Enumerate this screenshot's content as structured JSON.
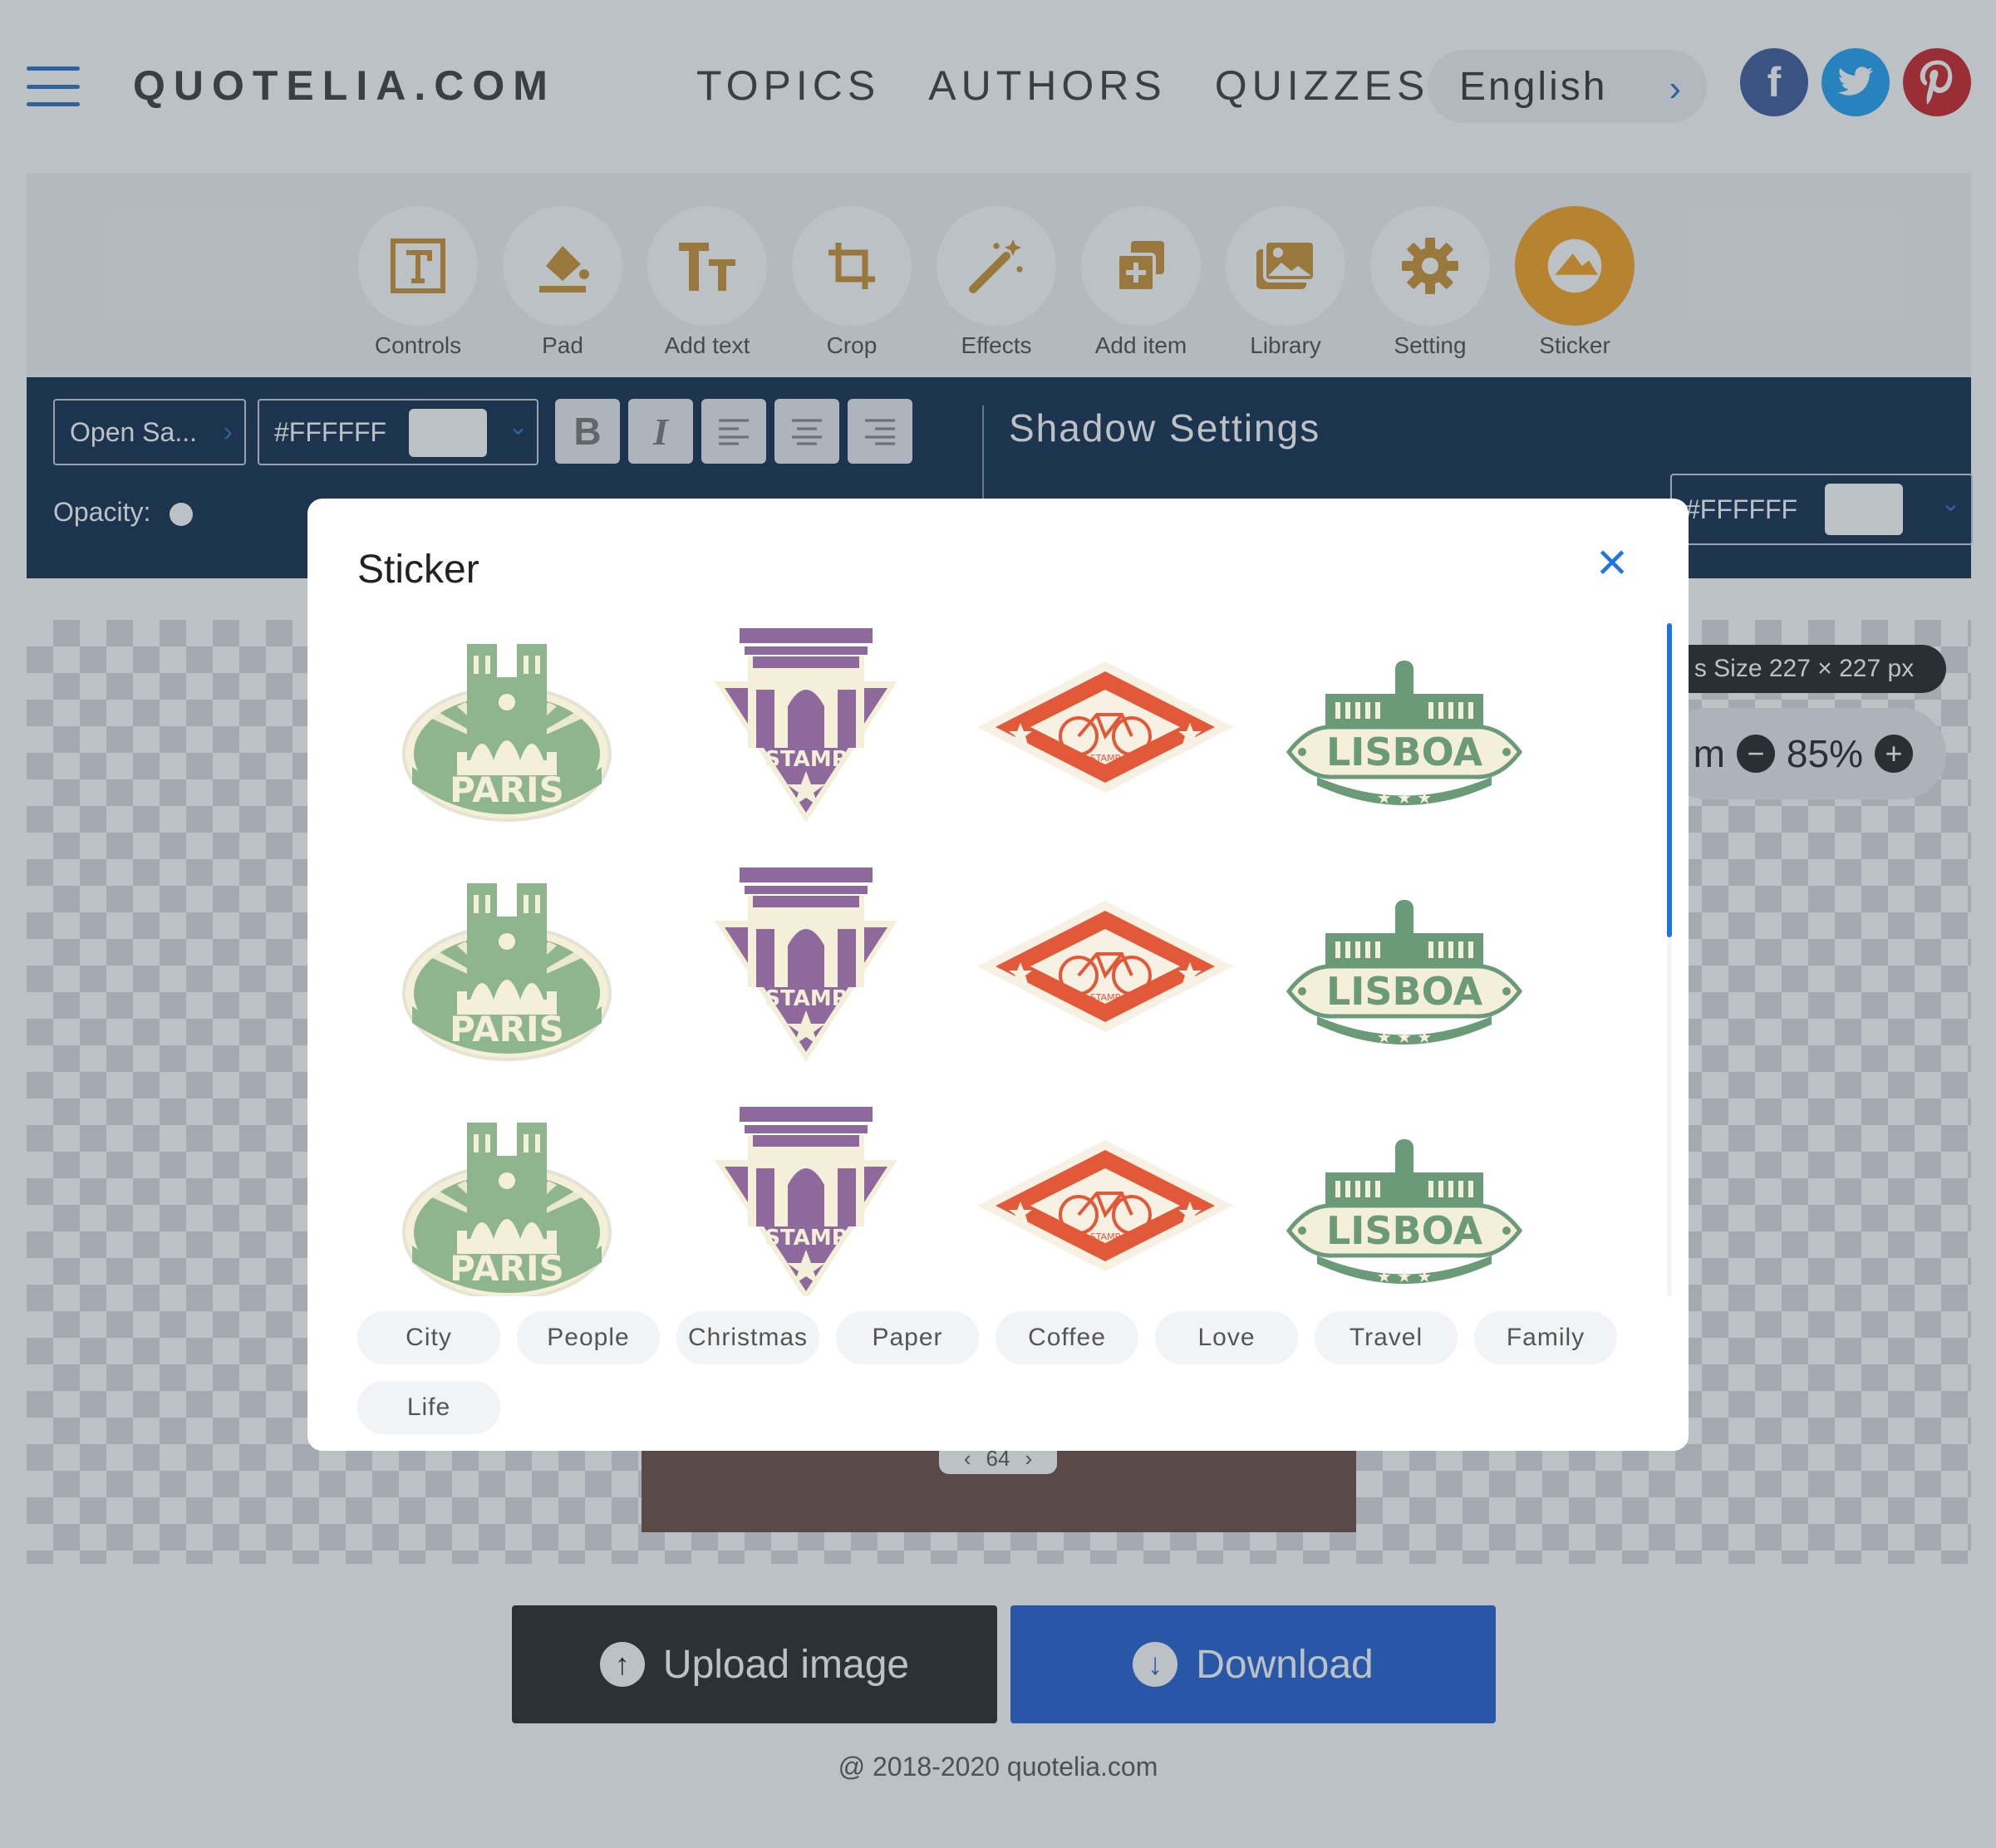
{
  "header": {
    "logo": "QUOTELIA.COM",
    "nav": [
      "TOPICS",
      "AUTHORS",
      "QUIZZES"
    ],
    "language": "English",
    "social": {
      "facebook": "f",
      "twitter": "t",
      "pinterest": "p"
    }
  },
  "toolbar": {
    "tools": [
      {
        "label": "Controls",
        "icon": "text-frame-icon"
      },
      {
        "label": "Pad",
        "icon": "paint-bucket-icon"
      },
      {
        "label": "Add text",
        "icon": "text-size-icon"
      },
      {
        "label": "Crop",
        "icon": "crop-icon"
      },
      {
        "label": "Effects",
        "icon": "magic-wand-icon"
      },
      {
        "label": "Add item",
        "icon": "add-layers-icon"
      },
      {
        "label": "Library",
        "icon": "images-icon"
      },
      {
        "label": "Setting",
        "icon": "gear-icon"
      },
      {
        "label": "Sticker",
        "icon": "sticker-icon"
      }
    ],
    "active": "Sticker",
    "accent": "#f6a21e"
  },
  "settings": {
    "font": "Open Sa...",
    "text_color": "#FFFFFF",
    "opacity_label": "Opacity:",
    "shadow_title": "Shadow Settings",
    "shadow_color": "#FFFFFF"
  },
  "canvas": {
    "size_text": "s Size 227 × 227 px",
    "zoom_prefix": "m",
    "zoom": "85%",
    "page_indicator": "64"
  },
  "actions": {
    "upload": "Upload image",
    "download": "Download",
    "download_color": "#1f5fd1"
  },
  "footer": "@ 2018-2020 quotelia.com",
  "modal": {
    "title": "Sticker",
    "close": "×",
    "stickers": [
      {
        "kind": "paris",
        "text": "PARIS"
      },
      {
        "kind": "stamp",
        "text": "STAMP"
      },
      {
        "kind": "bike",
        "text": "STAMP"
      },
      {
        "kind": "lisboa",
        "text": "LISBOA"
      },
      {
        "kind": "paris",
        "text": "PARIS"
      },
      {
        "kind": "stamp",
        "text": "STAMP"
      },
      {
        "kind": "bike",
        "text": "STAMP"
      },
      {
        "kind": "lisboa",
        "text": "LISBOA"
      },
      {
        "kind": "paris",
        "text": "PARIS"
      },
      {
        "kind": "stamp",
        "text": "STAMP"
      },
      {
        "kind": "bike",
        "text": "STAMP"
      },
      {
        "kind": "lisboa",
        "text": "LISBOA"
      }
    ],
    "categories": [
      "City",
      "People",
      "Christmas",
      "Paper",
      "Coffee",
      "Love",
      "Travel",
      "Family",
      "Life"
    ]
  }
}
